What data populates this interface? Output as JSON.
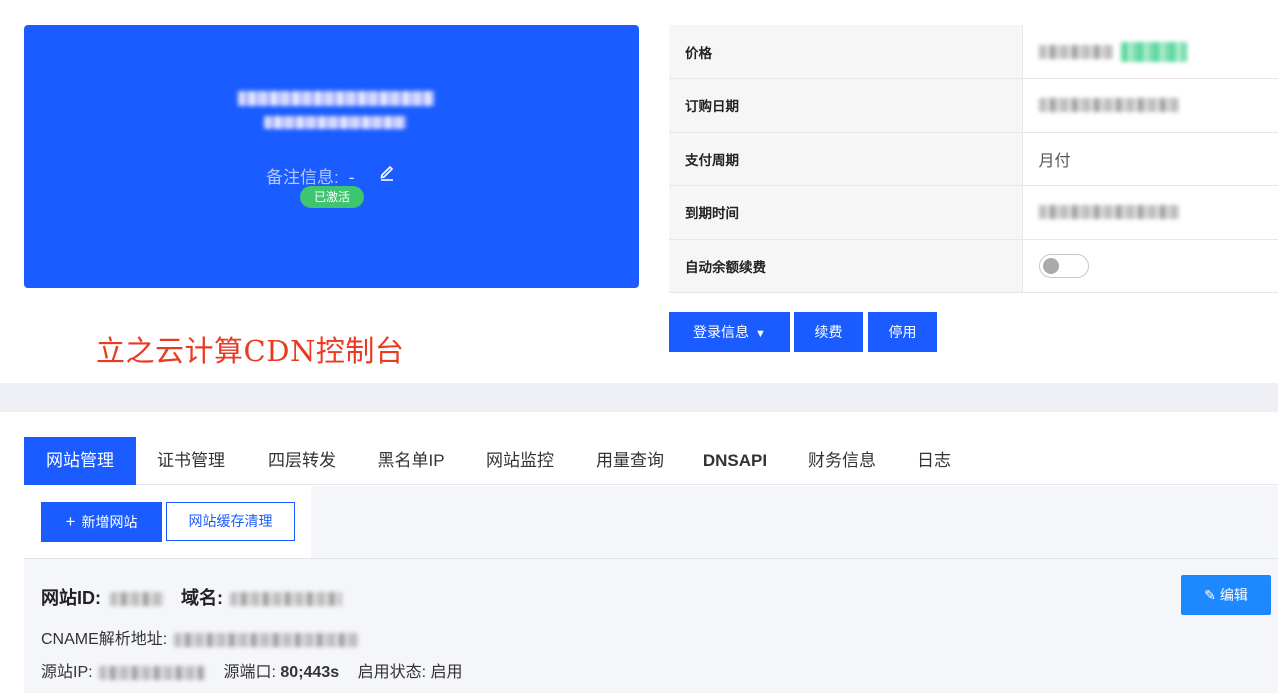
{
  "card": {
    "remark_label": "备注信息:",
    "remark_value": "-",
    "status_badge": "已激活"
  },
  "info_table": {
    "rows": [
      {
        "label": "价格"
      },
      {
        "label": "订购日期"
      },
      {
        "label": "支付周期",
        "value": "月付"
      },
      {
        "label": "到期时间"
      },
      {
        "label": "自动余额续费"
      }
    ],
    "auto_renew_enabled": false
  },
  "actions": {
    "login_info": "登录信息",
    "renew": "续费",
    "stop": "停用"
  },
  "brand_text": "立之云计算CDN控制台",
  "tabs": [
    "网站管理",
    "证书管理",
    "四层转发",
    "黑名单IP",
    "网站监控",
    "用量查询",
    "DNSAPI",
    "财务信息",
    "日志"
  ],
  "active_tab": "网站管理",
  "toolbar": {
    "add_site": "新增网站",
    "clear_cache": "网站缓存清理"
  },
  "site": {
    "id_label": "网站ID:",
    "domain_label": "域名:",
    "cname_label": "CNAME解析地址:",
    "origin_ip_label": "源站IP:",
    "origin_port_label": "源端口:",
    "origin_port_value": "80;443s",
    "status_label": "启用状态:",
    "status_value": "启用",
    "edit_button": "编辑"
  },
  "colors": {
    "primary": "#1a5cff",
    "success": "#3fc46f",
    "brand_red": "#ea3a22",
    "edit_blue": "#1e88ff"
  }
}
